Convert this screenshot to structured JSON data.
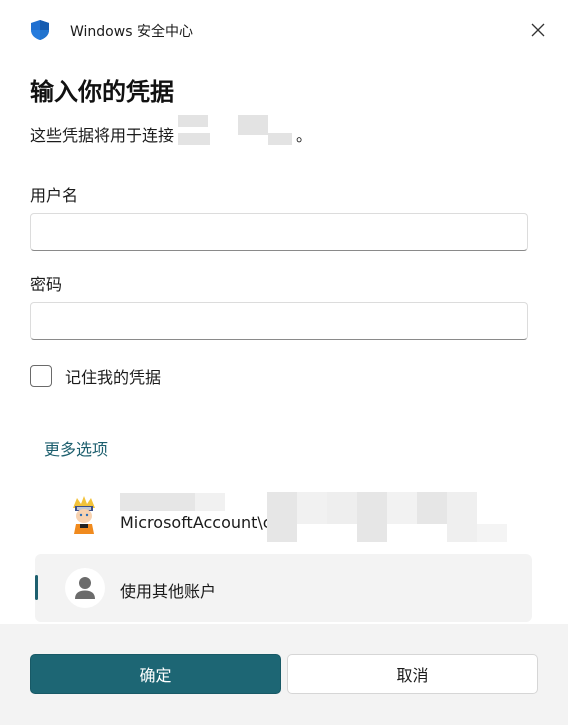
{
  "window": {
    "title": "Windows 安全中心",
    "close_icon": "close-icon",
    "app_icon": "shield-icon",
    "accent_color": "#1d6674"
  },
  "dialog": {
    "heading": "输入你的凭据",
    "subtext_prefix": "这些凭据将用于连接",
    "subtext_suffix": "。"
  },
  "form": {
    "username_label": "用户名",
    "username_value": "",
    "password_label": "密码",
    "password_value": "",
    "remember_label": "记住我的凭据",
    "remember_checked": false
  },
  "more_options": {
    "label": "更多选项",
    "accounts": [
      {
        "text": "MicrosoftAccount\\c",
        "icon": "user-avatar-icon",
        "selected": false
      },
      {
        "text": "使用其他账户",
        "icon": "person-icon",
        "selected": true
      }
    ]
  },
  "footer": {
    "confirm_label": "确定",
    "cancel_label": "取消"
  }
}
